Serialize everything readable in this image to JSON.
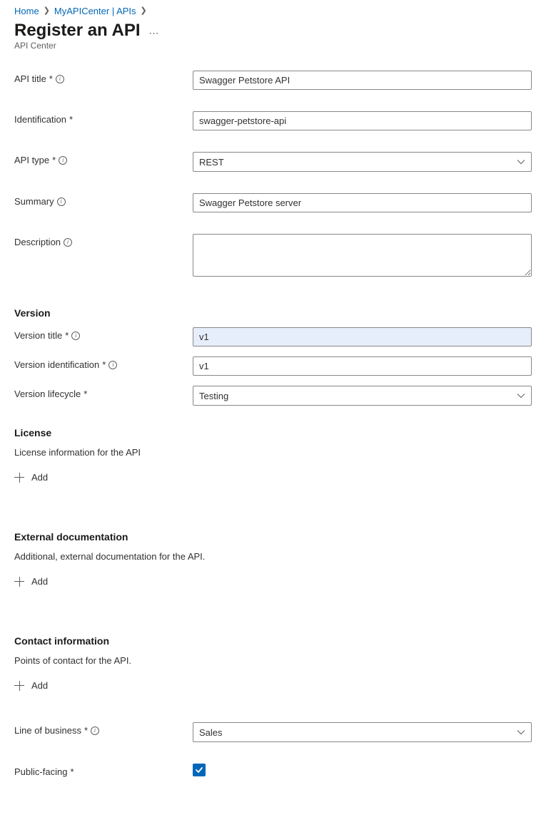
{
  "breadcrumb": {
    "home": "Home",
    "parent": "MyAPICenter | APIs"
  },
  "header": {
    "title": "Register an API",
    "subtitle": "API Center"
  },
  "fields": {
    "api_title": {
      "label": "API title",
      "value": "Swagger Petstore API"
    },
    "ident": {
      "label": "Identification",
      "value": "swagger-petstore-api"
    },
    "api_type": {
      "label": "API type",
      "value": "REST"
    },
    "summary": {
      "label": "Summary",
      "value": "Swagger Petstore server"
    },
    "description": {
      "label": "Description",
      "value": ""
    },
    "ver_title": {
      "label": "Version title",
      "value": "v1"
    },
    "ver_ident": {
      "label": "Version identification",
      "value": "v1"
    },
    "ver_life": {
      "label": "Version lifecycle",
      "value": "Testing"
    },
    "lob": {
      "label": "Line of business",
      "value": "Sales"
    },
    "public": {
      "label": "Public-facing"
    }
  },
  "sections": {
    "version": {
      "title": "Version"
    },
    "license": {
      "title": "License",
      "desc": "License information for the API"
    },
    "extdoc": {
      "title": "External documentation",
      "desc": "Additional, external documentation for the API."
    },
    "contact": {
      "title": "Contact information",
      "desc": "Points of contact for the API."
    }
  },
  "buttons": {
    "add": "Add"
  },
  "glyphs": {
    "req": "*",
    "info": "i"
  }
}
